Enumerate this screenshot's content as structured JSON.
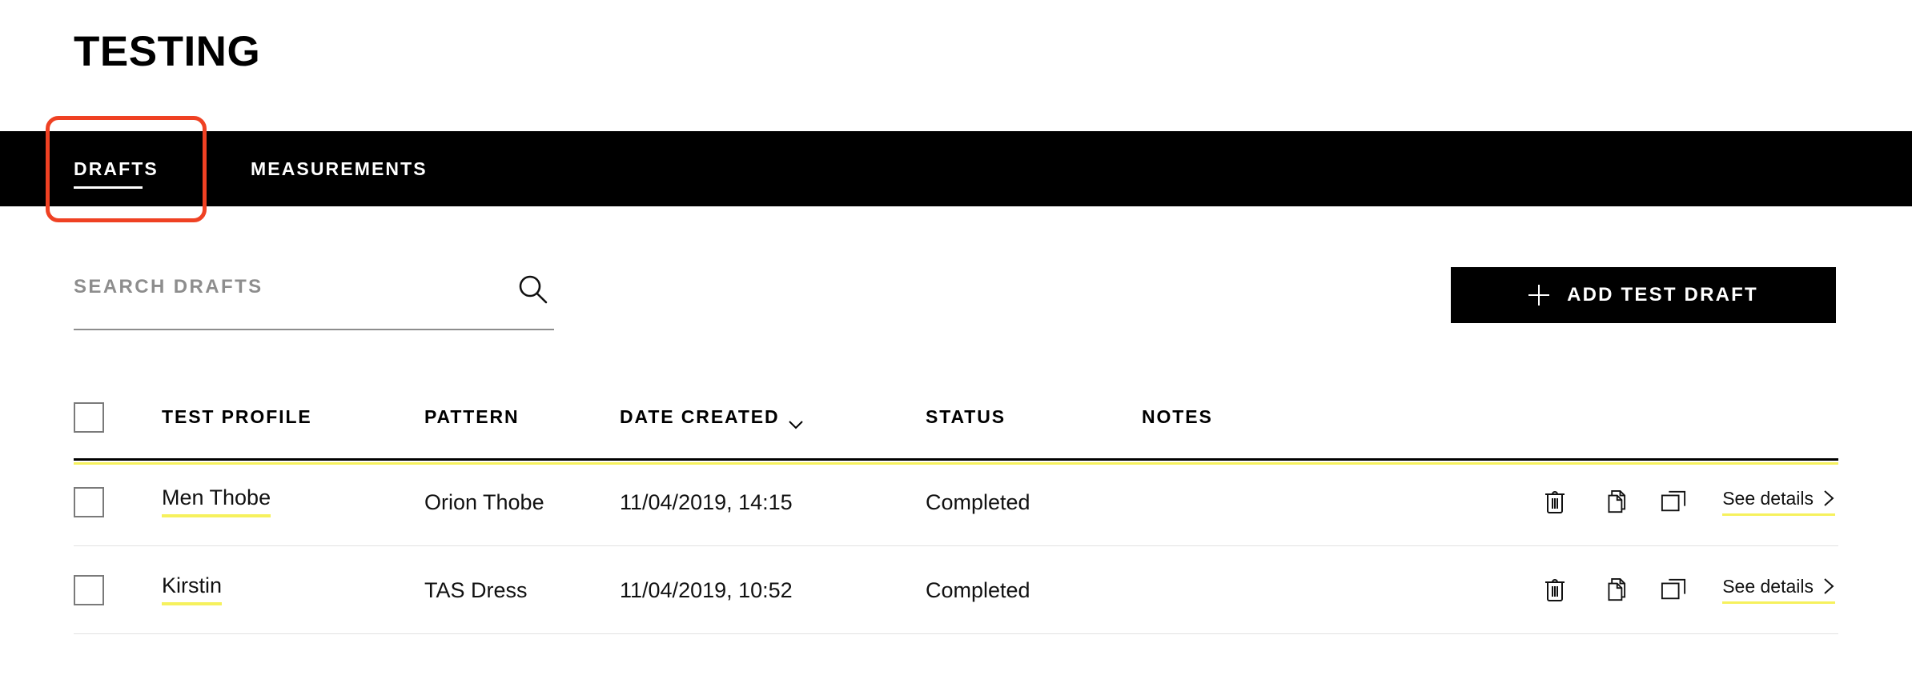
{
  "page": {
    "title": "TESTING"
  },
  "tabs": [
    {
      "id": "drafts",
      "label": "DRAFTS",
      "active": true,
      "highlighted": true
    },
    {
      "id": "measurements",
      "label": "MEASUREMENTS",
      "active": false,
      "highlighted": false
    }
  ],
  "annotation": {
    "target": "drafts-tab",
    "color": "#EF4123",
    "shape": "rounded-rectangle"
  },
  "search": {
    "placeholder": "SEARCH DRAFTS",
    "value": "",
    "icon": "search-icon"
  },
  "toolbar": {
    "add_button_label": "ADD TEST DRAFT",
    "add_button_icon": "plus-icon"
  },
  "table": {
    "select_all_checked": false,
    "columns": [
      {
        "key": "checkbox",
        "label": ""
      },
      {
        "key": "profile",
        "label": "TEST PROFILE"
      },
      {
        "key": "pattern",
        "label": "PATTERN"
      },
      {
        "key": "date",
        "label": "DATE CREATED",
        "sort_icon": "chevron-down-icon",
        "sorted": true
      },
      {
        "key": "status",
        "label": "STATUS"
      },
      {
        "key": "notes",
        "label": "NOTES"
      }
    ],
    "row_actions": [
      {
        "key": "delete",
        "icon": "trash-icon"
      },
      {
        "key": "duplicate",
        "icon": "copy-documents-icon"
      },
      {
        "key": "clone",
        "icon": "layers-icon"
      }
    ],
    "details_link_label": "See details",
    "details_link_icon": "chevron-right-icon",
    "rows": [
      {
        "checked": false,
        "profile": "Men Thobe",
        "pattern": "Orion Thobe",
        "date": "11/04/2019, 14:15",
        "status": "Completed",
        "notes": ""
      },
      {
        "checked": false,
        "profile": "Kirstin",
        "pattern": "TAS Dress",
        "date": "11/04/2019, 10:52",
        "status": "Completed",
        "notes": ""
      }
    ]
  },
  "colors": {
    "accent_yellow": "#F6F15D",
    "annotation_red": "#EF4123",
    "nav_background": "#000000",
    "placeholder_gray": "#8D8D8D"
  }
}
